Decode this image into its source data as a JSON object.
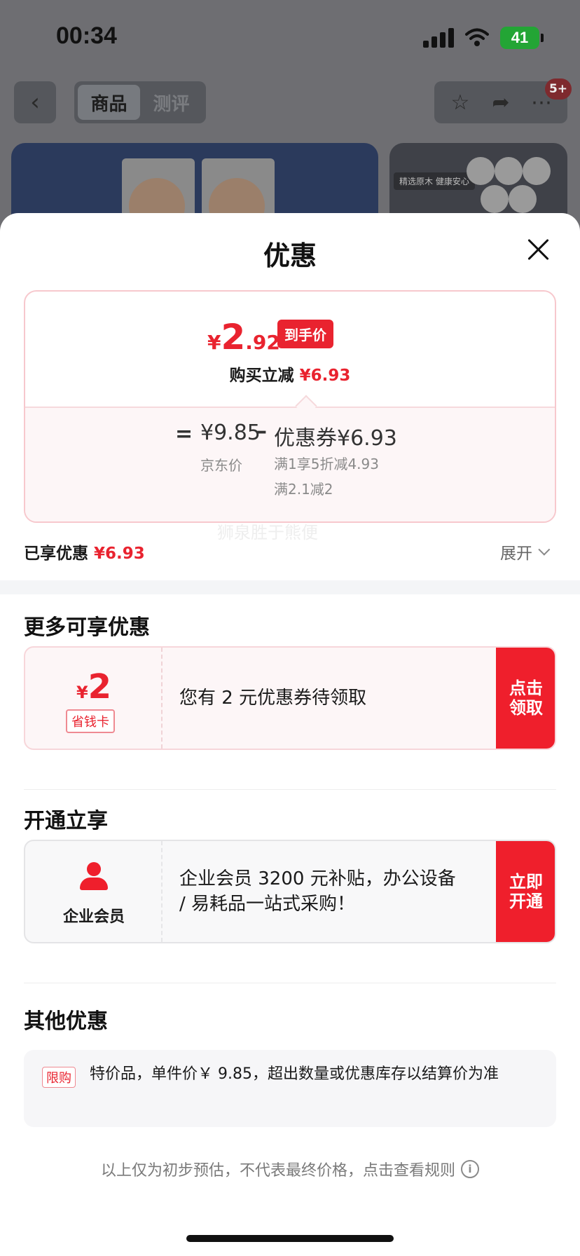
{
  "status": {
    "time": "00:34",
    "battery": "41"
  },
  "nav": {
    "tabs": [
      {
        "label": "商品",
        "active": true
      },
      {
        "label": "测评",
        "active": false
      }
    ],
    "badge": "5+"
  },
  "banner": {
    "side_text": "精选原木 健康安心"
  },
  "sheet": {
    "title": "优惠",
    "final_price": {
      "yen": "¥",
      "integer": "2",
      "decimal": ".92",
      "tag": "到手价"
    },
    "subtract": {
      "label": "购买立减",
      "value": "¥6.93"
    },
    "jd_price": {
      "value": "¥9.85",
      "label": "京东价"
    },
    "coupon": {
      "total": "优惠券¥6.93",
      "lines": [
        "满1享5折减4.93",
        "满2.1减2"
      ]
    },
    "enjoyed": {
      "label": "已享优惠",
      "value": "¥6.93"
    },
    "expand_label": "展开",
    "watermark": "狮泉胜于熊便"
  },
  "more": {
    "title": "更多可享优惠",
    "card": {
      "yen": "¥",
      "amount": "2",
      "tag": "省钱卡",
      "text": "您有 2 元优惠券待领取",
      "button": "点击领取"
    }
  },
  "open": {
    "title": "开通立享",
    "card": {
      "label": "企业会员",
      "text": "企业会员 3200 元补贴，办公设备 / 易耗品一站式采购！",
      "button": "立即开通"
    }
  },
  "other": {
    "title": "其他优惠",
    "tag": "限购",
    "text": "特价品，单件价￥ 9.85，超出数量或优惠库存以结算价为准"
  },
  "footnote": "以上仅为初步预估，不代表最终价格，点击查看规则",
  "colors": {
    "accent_red": "#e9232f",
    "button_red": "#ef1f2c"
  }
}
